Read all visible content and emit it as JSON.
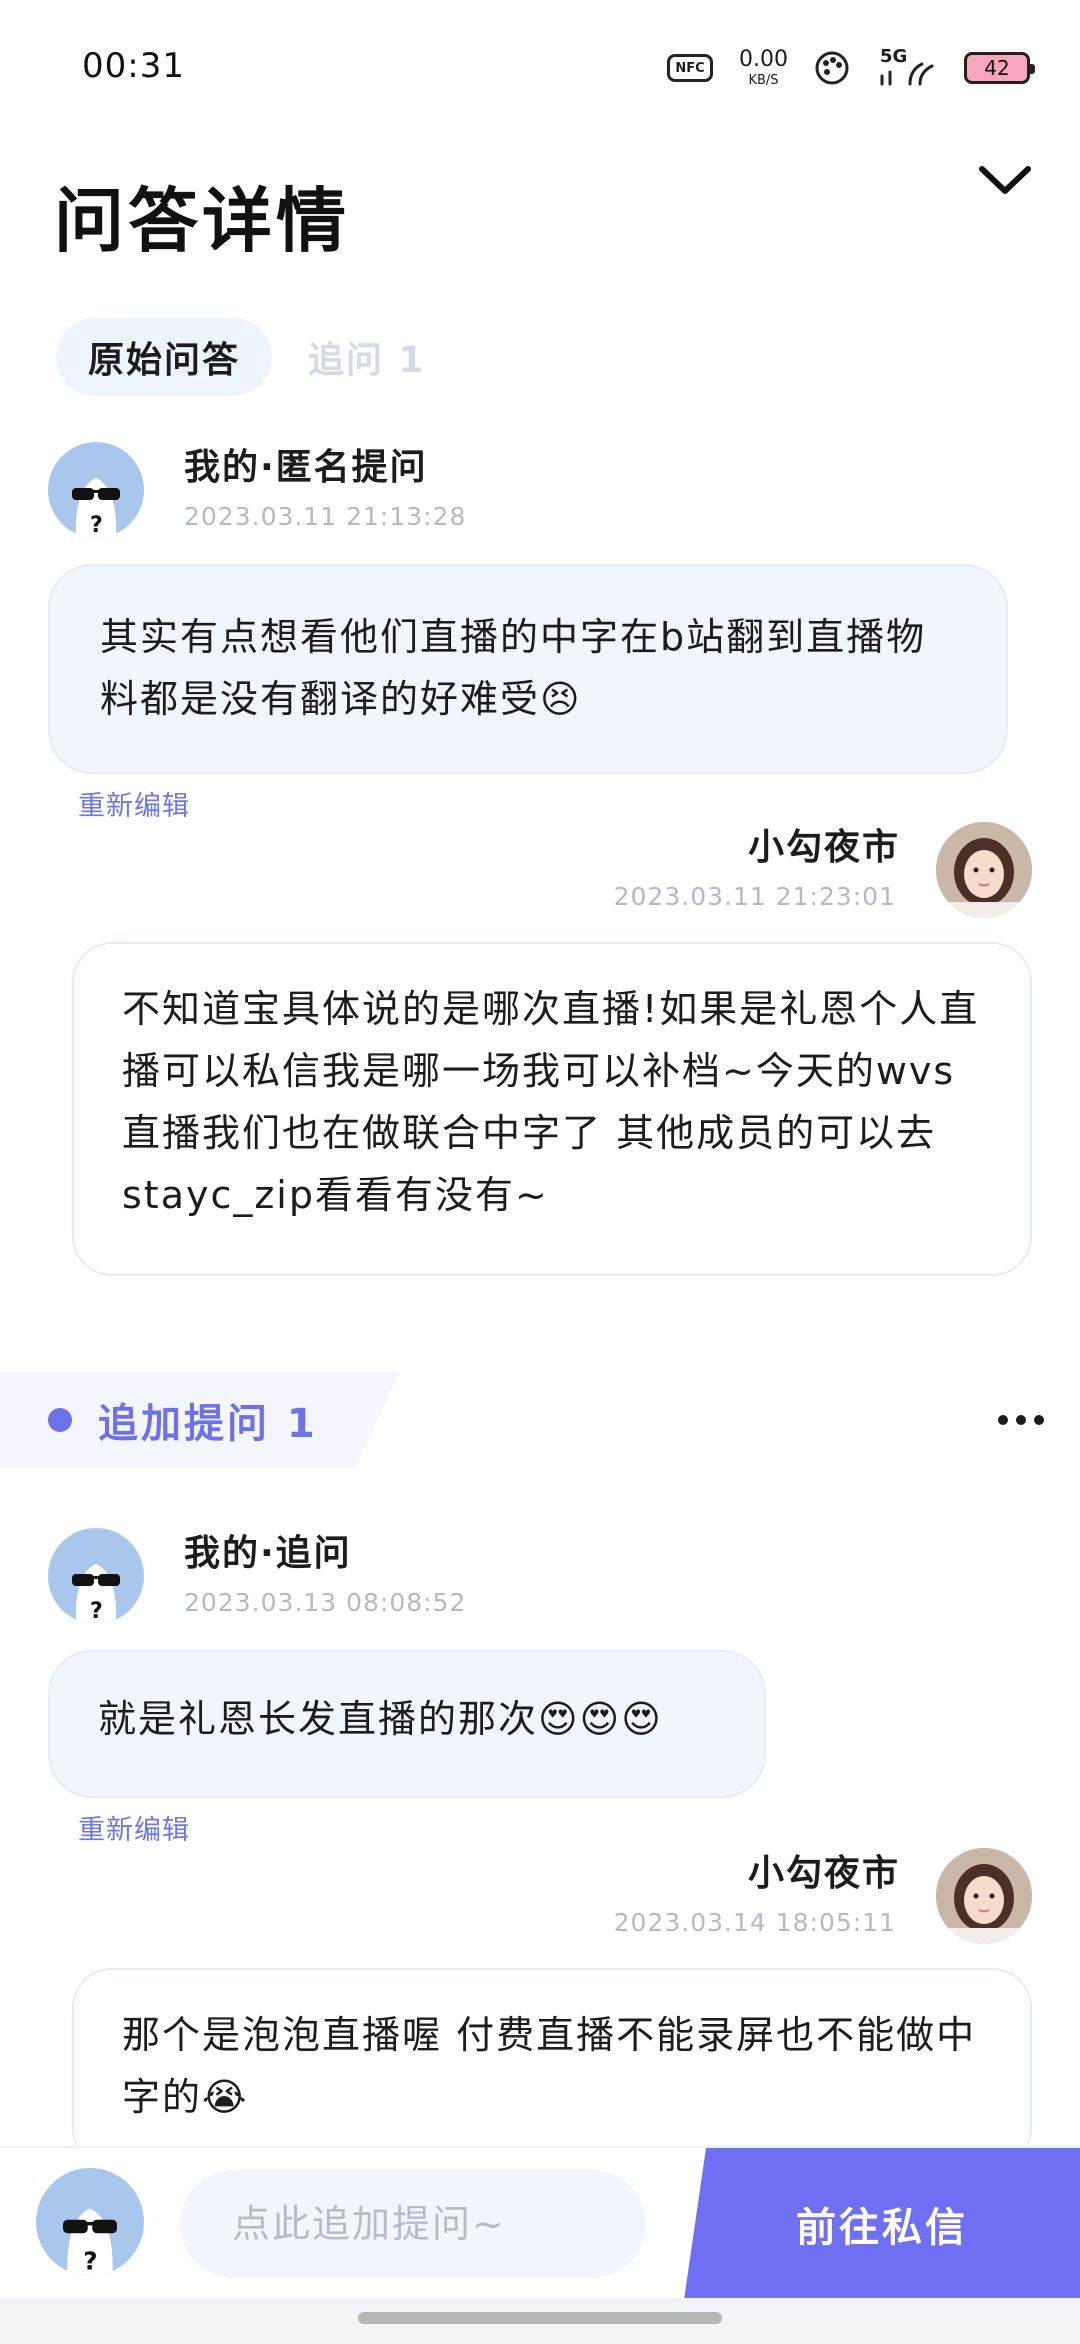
{
  "status": {
    "time": "00:31",
    "nfc": "NFC",
    "net_speed_value": "0.00",
    "net_speed_unit": "KB/S",
    "signal": "5G",
    "battery": "42"
  },
  "header": {
    "title": "问答详情"
  },
  "tabs": [
    {
      "label": "原始问答",
      "active": true
    },
    {
      "label": "追问 1",
      "active": false
    }
  ],
  "thread": {
    "q1": {
      "name": "我的·匿名提问",
      "time": "2023.03.11 21:13:28",
      "text": "其实有点想看他们直播的中字在b站翻到直播物料都是没有翻译的好难受😣",
      "reedit": "重新编辑"
    },
    "a1": {
      "name": "小勾夜市",
      "time": "2023.03.11 21:23:01",
      "text": "不知道宝具体说的是哪次直播!如果是礼恩个人直播可以私信我是哪一场我可以补档~今天的wvs直播我们也在做联合中字了 其他成员的可以去stayc_zip看看有没有~"
    },
    "followup_label": "追加提问 1",
    "q2": {
      "name": "我的·追问",
      "time": "2023.03.13 08:08:52",
      "text": "就是礼恩长发直播的那次😍😍😍",
      "reedit": "重新编辑"
    },
    "a2": {
      "name": "小勾夜市",
      "time": "2023.03.14 18:05:11",
      "text": "那个是泡泡直播喔 付费直播不能录屏也不能做中字的😭"
    }
  },
  "bottom": {
    "input_placeholder": "点此追加提问~",
    "dm_label": "前往私信"
  }
}
